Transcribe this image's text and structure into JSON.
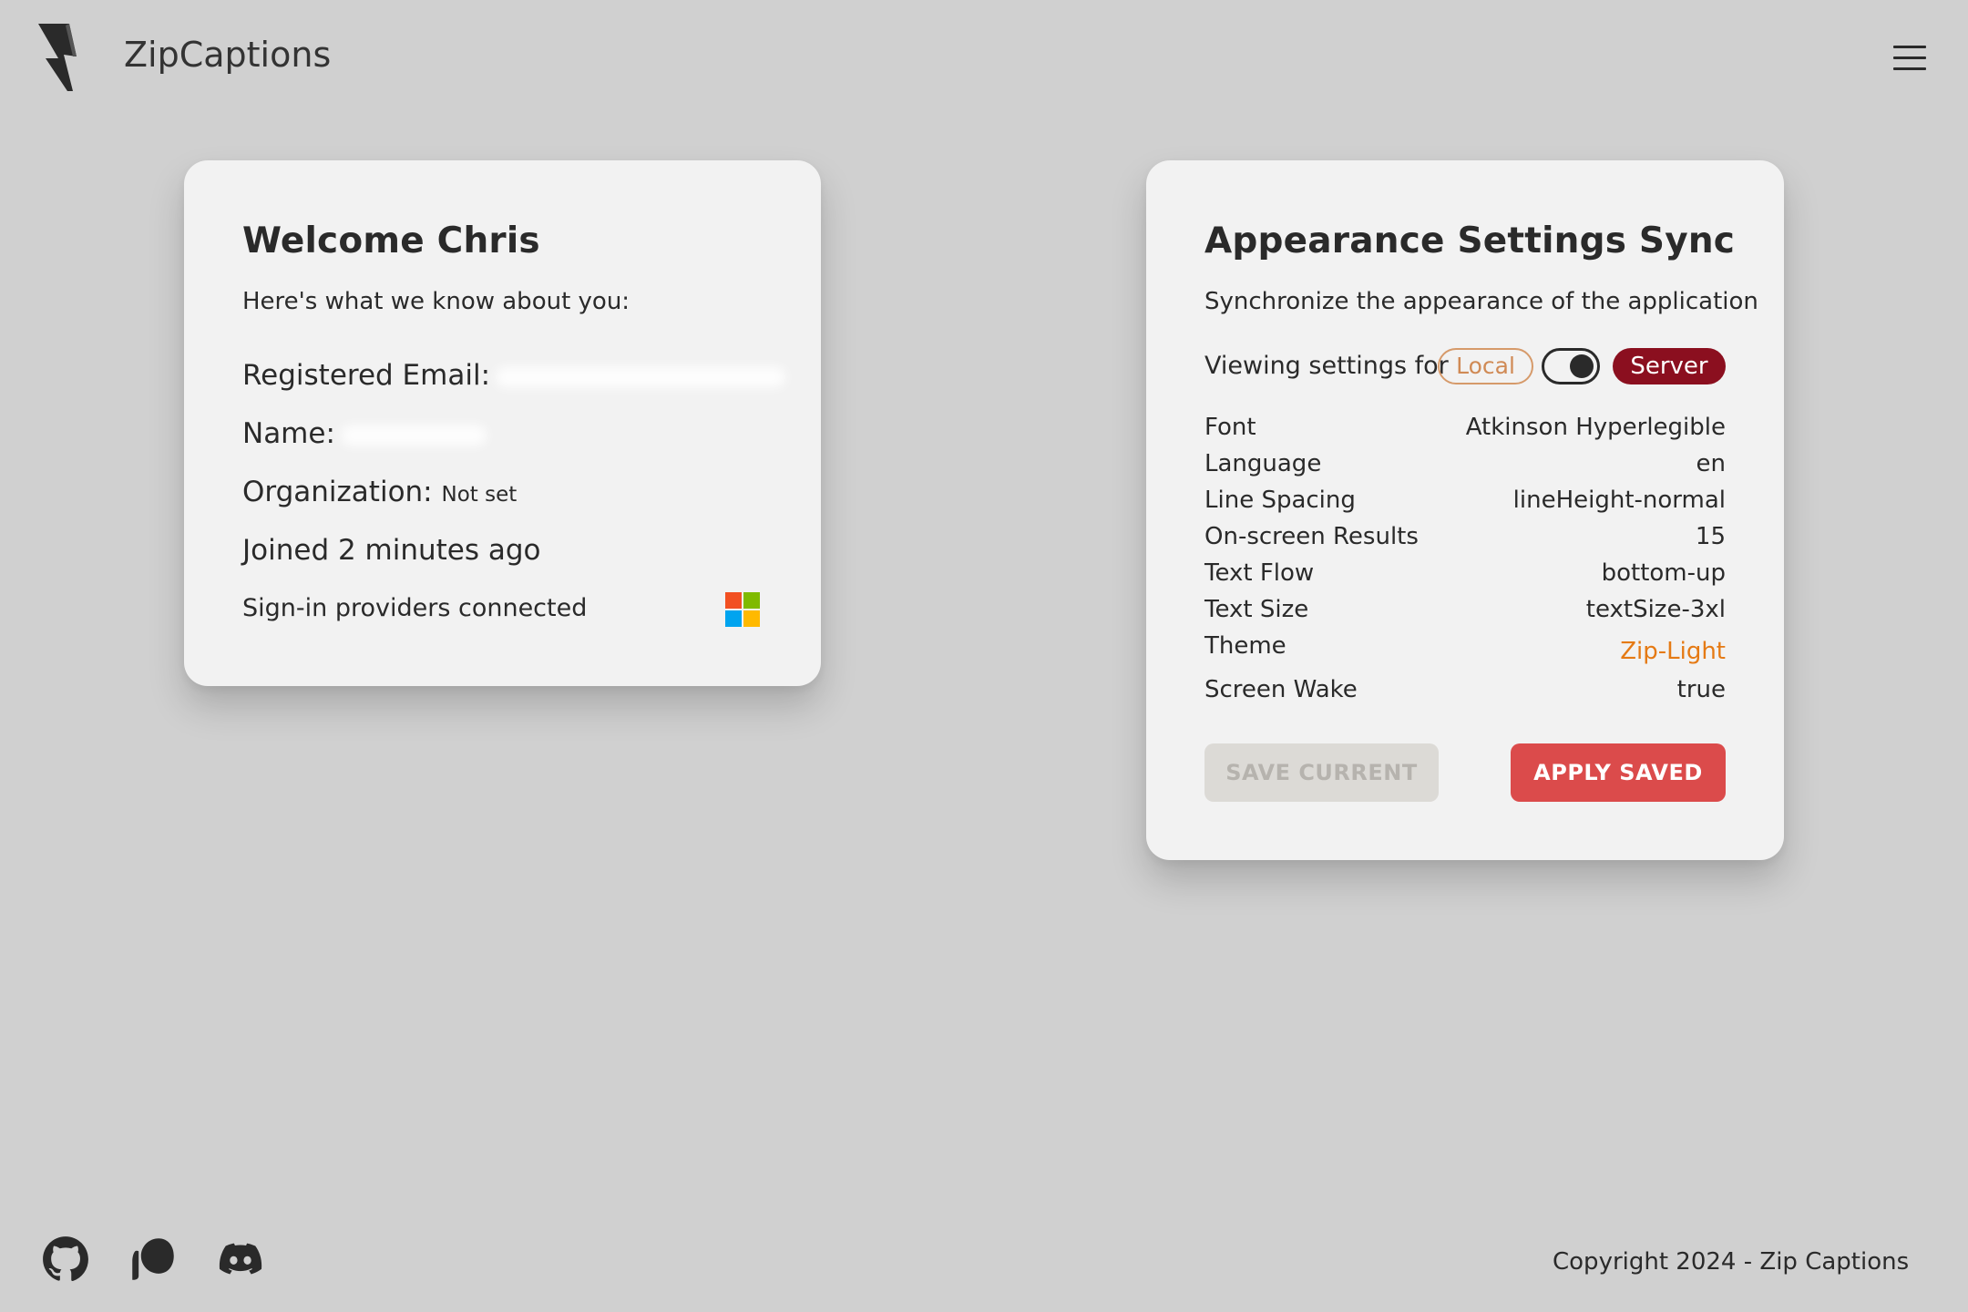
{
  "header": {
    "app_title": "ZipCaptions",
    "logo_icon": "lightning-bolt-logo-icon",
    "menu_icon": "hamburger-menu-icon"
  },
  "profile_card": {
    "title": "Welcome Chris",
    "subtitle": "Here's what we know about you:",
    "email_label": "Registered Email:",
    "name_label": "Name:",
    "organization_label": "Organization:",
    "organization_value": "Not set",
    "joined": "Joined 2 minutes ago",
    "providers_label": "Sign-in providers connected",
    "provider_icon": "microsoft-logo-icon",
    "provider_colors": [
      "#f25022",
      "#7fba00",
      "#00a4ef",
      "#ffb900"
    ]
  },
  "settings_card": {
    "title": "Appearance Settings Sync",
    "subtitle": "Synchronize the appearance of the application",
    "viewing_label": "Viewing settings for",
    "local_label": "Local",
    "server_label": "Server",
    "toggle_state": "server",
    "rows": [
      {
        "key": "Font",
        "value": "Atkinson Hyperlegible"
      },
      {
        "key": "Language",
        "value": "en"
      },
      {
        "key": "Line Spacing",
        "value": "lineHeight-normal"
      },
      {
        "key": "On-screen Results",
        "value": "15"
      },
      {
        "key": "Text Flow",
        "value": "bottom-up"
      },
      {
        "key": "Text Size",
        "value": "textSize-3xl"
      },
      {
        "key": "Theme",
        "value": "Zip-Light"
      },
      {
        "key": "Screen Wake",
        "value": "true"
      }
    ],
    "save_button": "SAVE CURRENT",
    "apply_button": "APPLY SAVED",
    "colors": {
      "accent_red": "#db4b4b",
      "server_pill": "#8b0f1f",
      "theme_value": "#e57a14"
    }
  },
  "footer": {
    "icons": [
      "github-icon",
      "patreon-icon",
      "discord-icon"
    ],
    "copyright": "Copyright 2024 - Zip Captions"
  }
}
